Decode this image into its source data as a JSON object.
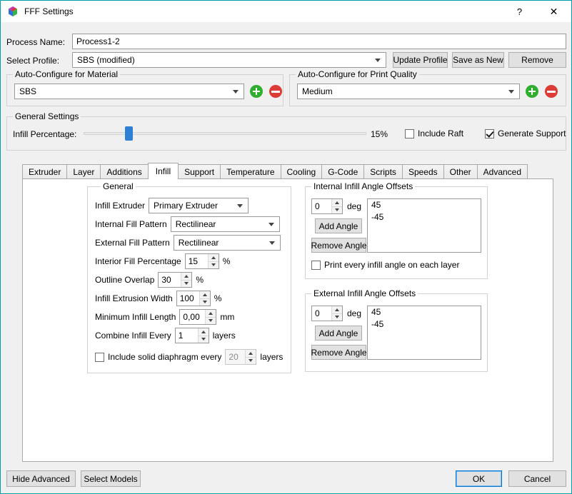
{
  "window": {
    "title": "FFF Settings",
    "help": "?",
    "close": "✕"
  },
  "header": {
    "process_name_label": "Process Name:",
    "process_name_value": "Process1-2",
    "select_profile_label": "Select Profile:",
    "profile_value": "SBS (modified)",
    "update_profile_label": "Update Profile",
    "save_as_new_label": "Save as New",
    "remove_label": "Remove"
  },
  "auto_material": {
    "title": "Auto-Configure for Material",
    "value": "SBS"
  },
  "auto_quality": {
    "title": "Auto-Configure for Print Quality",
    "value": "Medium"
  },
  "general_settings": {
    "title": "General Settings",
    "infill_label": "Infill Percentage:",
    "infill_value": "15%",
    "slider_percent": 15,
    "include_raft_label": "Include Raft",
    "include_raft_checked": false,
    "generate_support_label": "Generate Support",
    "generate_support_checked": true
  },
  "tabs": [
    "Extruder",
    "Layer",
    "Additions",
    "Infill",
    "Support",
    "Temperature",
    "Cooling",
    "G-Code",
    "Scripts",
    "Speeds",
    "Other",
    "Advanced"
  ],
  "active_tab": "Infill",
  "infill_general": {
    "title": "General",
    "infill_extruder_label": "Infill Extruder",
    "infill_extruder_value": "Primary Extruder",
    "internal_pattern_label": "Internal Fill Pattern",
    "internal_pattern_value": "Rectilinear",
    "external_pattern_label": "External Fill Pattern",
    "external_pattern_value": "Rectilinear",
    "interior_fill_label": "Interior Fill Percentage",
    "interior_fill_value": "15",
    "interior_fill_unit": "%",
    "outline_overlap_label": "Outline Overlap",
    "outline_overlap_value": "30",
    "outline_overlap_unit": "%",
    "extrusion_width_label": "Infill Extrusion Width",
    "extrusion_width_value": "100",
    "extrusion_width_unit": "%",
    "min_length_label": "Minimum Infill Length",
    "min_length_value": "0,00",
    "min_length_unit": "mm",
    "combine_label": "Combine Infill Every",
    "combine_value": "1",
    "combine_unit": "layers",
    "diaphragm_label": "Include solid diaphragm every",
    "diaphragm_checked": false,
    "diaphragm_value": "20",
    "diaphragm_unit": "layers"
  },
  "internal_offsets": {
    "title": "Internal Infill Angle Offsets",
    "angle_value": "0",
    "angle_unit": "deg",
    "add_label": "Add Angle",
    "remove_label": "Remove Angle",
    "angles": [
      "45",
      "-45"
    ],
    "per_layer_label": "Print every infill angle on each layer",
    "per_layer_checked": false
  },
  "external_offsets": {
    "title": "External Infill Angle Offsets",
    "angle_value": "0",
    "angle_unit": "deg",
    "add_label": "Add Angle",
    "remove_label": "Remove Angle",
    "angles": [
      "45",
      "-45"
    ]
  },
  "footer": {
    "hide_advanced_label": "Hide Advanced",
    "select_models_label": "Select Models",
    "ok_label": "OK",
    "cancel_label": "Cancel"
  },
  "colors": {
    "window_border": "#00a0aa",
    "slider_handle": "#2e80d6",
    "add_green": "#2fae2f",
    "remove_red": "#dd3b36"
  }
}
